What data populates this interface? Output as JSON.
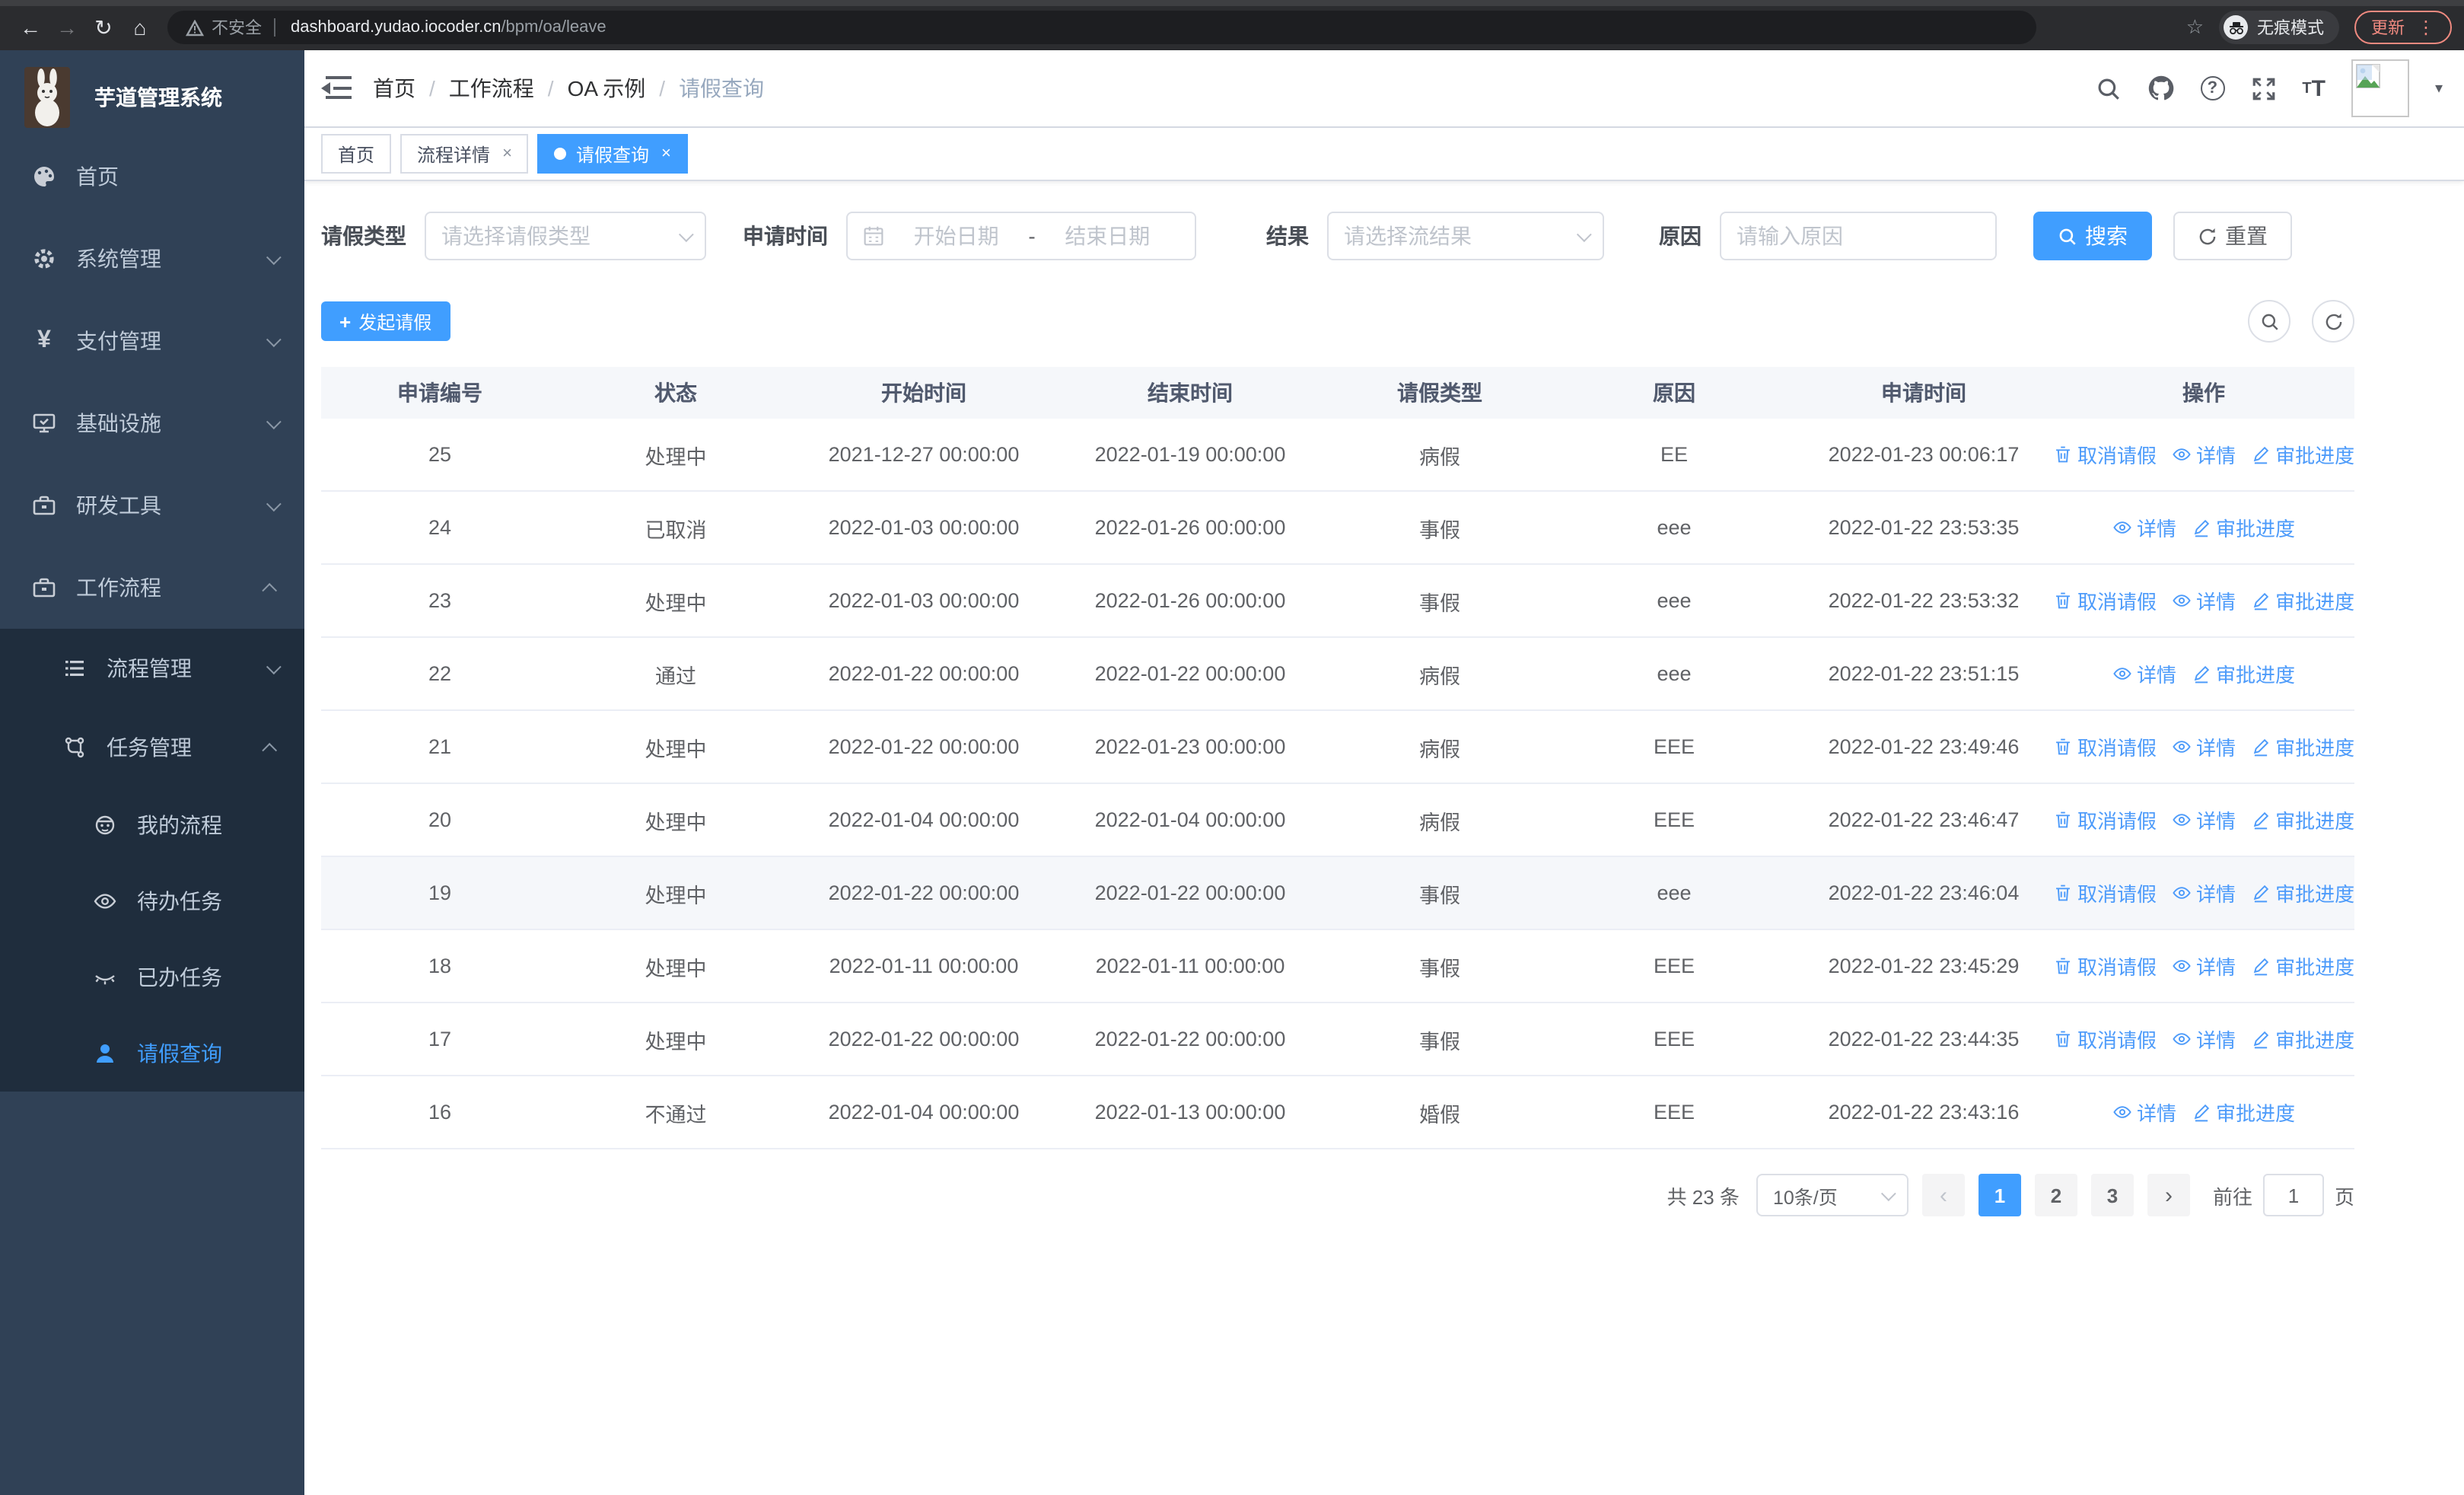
{
  "browser": {
    "security_label": "不安全",
    "url_host": "dashboard.yudao.iocoder.cn",
    "url_path": "/bpm/oa/leave",
    "incognito_label": "无痕模式",
    "update_label": "更新"
  },
  "sidebar": {
    "app_title": "芋道管理系统",
    "items": [
      {
        "label": "首页",
        "icon": "dashboard-icon"
      },
      {
        "label": "系统管理",
        "icon": "gear-icon"
      },
      {
        "label": "支付管理",
        "icon": "yen-icon"
      },
      {
        "label": "基础设施",
        "icon": "monitor-icon"
      },
      {
        "label": "研发工具",
        "icon": "toolbox-icon"
      },
      {
        "label": "工作流程",
        "icon": "toolbox-icon"
      }
    ],
    "sub_items": [
      {
        "label": "流程管理",
        "icon": "list-icon"
      },
      {
        "label": "任务管理",
        "icon": "branch-icon"
      }
    ],
    "task_items": [
      {
        "label": "我的流程",
        "icon": "robot-icon"
      },
      {
        "label": "待办任务",
        "icon": "eye-icon"
      },
      {
        "label": "已办任务",
        "icon": "eye-closed-icon"
      },
      {
        "label": "请假查询",
        "icon": "user-icon",
        "active": true
      }
    ]
  },
  "breadcrumb": {
    "items": [
      "首页",
      "工作流程",
      "OA 示例",
      "请假查询"
    ]
  },
  "tabs": [
    {
      "label": "首页",
      "closable": false,
      "active": false
    },
    {
      "label": "流程详情",
      "closable": true,
      "active": false
    },
    {
      "label": "请假查询",
      "closable": true,
      "active": true
    }
  ],
  "query": {
    "leave_type_label": "请假类型",
    "leave_type_placeholder": "请选择请假类型",
    "apply_time_label": "申请时间",
    "start_date_placeholder": "开始日期",
    "range_separator": "-",
    "end_date_placeholder": "结束日期",
    "result_label": "结果",
    "result_placeholder": "请选择流结果",
    "reason_label": "原因",
    "reason_placeholder": "请输入原因",
    "search_label": "搜索",
    "reset_label": "重置"
  },
  "toolbar": {
    "create_label": "发起请假"
  },
  "table": {
    "columns": [
      "申请编号",
      "状态",
      "开始时间",
      "结束时间",
      "请假类型",
      "原因",
      "申请时间",
      "操作"
    ],
    "action_labels": {
      "cancel": "取消请假",
      "detail": "详情",
      "progress": "审批进度"
    },
    "rows": [
      {
        "id": "25",
        "status": "处理中",
        "start": "2021-12-27 00:00:00",
        "end": "2022-01-19 00:00:00",
        "type": "病假",
        "reason": "EE",
        "apply": "2022-01-23 00:06:17",
        "actions": [
          "cancel",
          "detail",
          "progress"
        ],
        "highlight": false
      },
      {
        "id": "24",
        "status": "已取消",
        "start": "2022-01-03 00:00:00",
        "end": "2022-01-26 00:00:00",
        "type": "事假",
        "reason": "eee",
        "apply": "2022-01-22 23:53:35",
        "actions": [
          "detail",
          "progress"
        ],
        "highlight": false
      },
      {
        "id": "23",
        "status": "处理中",
        "start": "2022-01-03 00:00:00",
        "end": "2022-01-26 00:00:00",
        "type": "事假",
        "reason": "eee",
        "apply": "2022-01-22 23:53:32",
        "actions": [
          "cancel",
          "detail",
          "progress"
        ],
        "highlight": false
      },
      {
        "id": "22",
        "status": "通过",
        "start": "2022-01-22 00:00:00",
        "end": "2022-01-22 00:00:00",
        "type": "病假",
        "reason": "eee",
        "apply": "2022-01-22 23:51:15",
        "actions": [
          "detail",
          "progress"
        ],
        "highlight": false
      },
      {
        "id": "21",
        "status": "处理中",
        "start": "2022-01-22 00:00:00",
        "end": "2022-01-23 00:00:00",
        "type": "病假",
        "reason": "EEE",
        "apply": "2022-01-22 23:49:46",
        "actions": [
          "cancel",
          "detail",
          "progress"
        ],
        "highlight": false
      },
      {
        "id": "20",
        "status": "处理中",
        "start": "2022-01-04 00:00:00",
        "end": "2022-01-04 00:00:00",
        "type": "病假",
        "reason": "EEE",
        "apply": "2022-01-22 23:46:47",
        "actions": [
          "cancel",
          "detail",
          "progress"
        ],
        "highlight": false
      },
      {
        "id": "19",
        "status": "处理中",
        "start": "2022-01-22 00:00:00",
        "end": "2022-01-22 00:00:00",
        "type": "事假",
        "reason": "eee",
        "apply": "2022-01-22 23:46:04",
        "actions": [
          "cancel",
          "detail",
          "progress"
        ],
        "highlight": true
      },
      {
        "id": "18",
        "status": "处理中",
        "start": "2022-01-11 00:00:00",
        "end": "2022-01-11 00:00:00",
        "type": "事假",
        "reason": "EEE",
        "apply": "2022-01-22 23:45:29",
        "actions": [
          "cancel",
          "detail",
          "progress"
        ],
        "highlight": false
      },
      {
        "id": "17",
        "status": "处理中",
        "start": "2022-01-22 00:00:00",
        "end": "2022-01-22 00:00:00",
        "type": "事假",
        "reason": "EEE",
        "apply": "2022-01-22 23:44:35",
        "actions": [
          "cancel",
          "detail",
          "progress"
        ],
        "highlight": false
      },
      {
        "id": "16",
        "status": "不通过",
        "start": "2022-01-04 00:00:00",
        "end": "2022-01-13 00:00:00",
        "type": "婚假",
        "reason": "EEE",
        "apply": "2022-01-22 23:43:16",
        "actions": [
          "detail",
          "progress"
        ],
        "highlight": false
      }
    ]
  },
  "pagination": {
    "total": "共 23 条",
    "page_size": "10条/页",
    "pages": [
      "1",
      "2",
      "3"
    ],
    "active_page": "1",
    "goto_label": "前往",
    "goto_value": "1",
    "page_unit": "页"
  },
  "colors": {
    "primary": "#409EFF",
    "sidebar_bg": "#304156",
    "submenu_bg": "#1f2d3d",
    "update_badge": "#f08a80"
  }
}
